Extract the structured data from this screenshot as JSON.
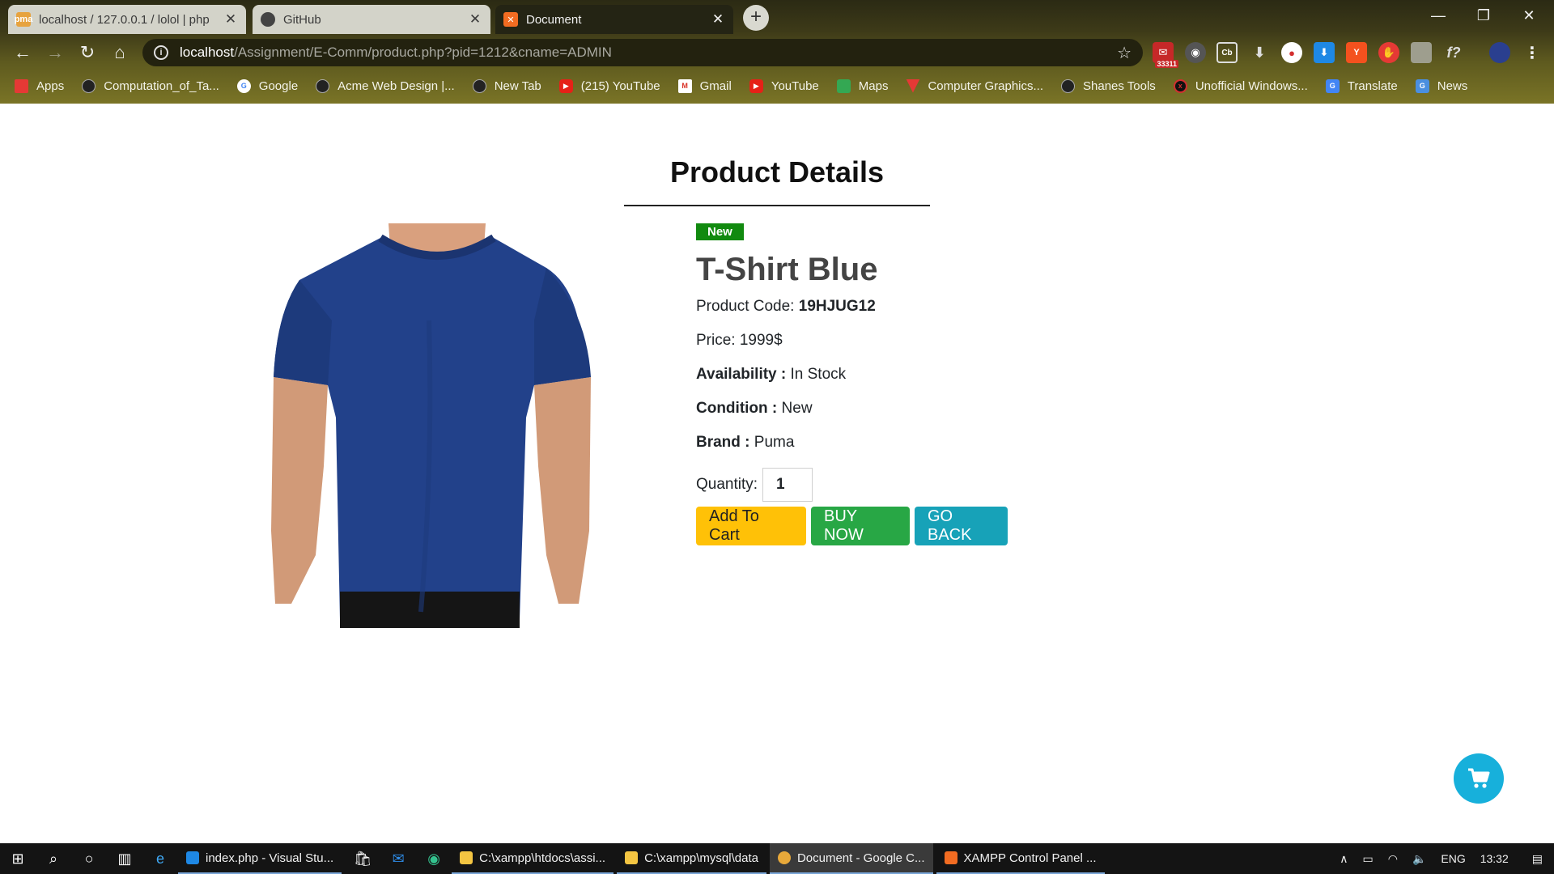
{
  "browser": {
    "tabs": [
      {
        "title": "localhost / 127.0.0.1 / lolol | php",
        "icon": "phpmyadmin-icon"
      },
      {
        "title": "GitHub",
        "icon": "github-icon"
      },
      {
        "title": "Document",
        "icon": "xampp-icon"
      }
    ],
    "url_host": "localhost",
    "url_path": "/Assignment/E-Comm/product.php?pid=1212&cname=ADMIN",
    "extension_badge": "33311",
    "bookmarks": [
      {
        "label": "Apps",
        "icon": "apps-grid-icon"
      },
      {
        "label": "Computation_of_Ta...",
        "icon": "globe-icon"
      },
      {
        "label": "Google",
        "icon": "google-icon"
      },
      {
        "label": "Acme Web Design |...",
        "icon": "globe-icon"
      },
      {
        "label": "New Tab",
        "icon": "globe-icon"
      },
      {
        "label": "(215) YouTube",
        "icon": "youtube-icon"
      },
      {
        "label": "Gmail",
        "icon": "gmail-icon"
      },
      {
        "label": "YouTube",
        "icon": "youtube-icon"
      },
      {
        "label": "Maps",
        "icon": "maps-icon"
      },
      {
        "label": "Computer Graphics...",
        "icon": "vivaldi-icon"
      },
      {
        "label": "Shanes Tools",
        "icon": "globe-icon"
      },
      {
        "label": "Unofficial Windows...",
        "icon": "red-circle-icon"
      },
      {
        "label": "Translate",
        "icon": "translate-icon"
      },
      {
        "label": "News",
        "icon": "news-icon"
      }
    ]
  },
  "page": {
    "heading": "Product Details",
    "badge": "New",
    "product_name": "T-Shirt Blue",
    "code_label": "Product Code:",
    "code_value": "19HJUG12",
    "price_text": "Price: 1999$",
    "availability_label": "Availability :",
    "availability_value": "In Stock",
    "condition_label": "Condition :",
    "condition_value": "New",
    "brand_label": "Brand :",
    "brand_value": "Puma",
    "quantity_label": "Quantity:",
    "quantity_value": "1",
    "buttons": {
      "add_to_cart": "Add To Cart",
      "buy_now": "BUY NOW",
      "go_back": "GO BACK"
    },
    "colors": {
      "badge": "#118a0f",
      "add_to_cart": "#ffc107",
      "buy_now": "#28a745",
      "go_back": "#17a2b8",
      "floating_cart": "#17b0db",
      "shirt": "#22418a"
    }
  },
  "taskbar": {
    "apps": [
      {
        "label": "index.php - Visual Stu...",
        "icon": "vscode-icon"
      },
      {
        "label": "C:\\xampp\\htdocs\\assi...",
        "icon": "folder-icon"
      },
      {
        "label": "C:\\xampp\\mysql\\data",
        "icon": "folder-icon"
      },
      {
        "label": "Document - Google C...",
        "icon": "chrome-icon"
      },
      {
        "label": "XAMPP Control Panel ...",
        "icon": "xampp-icon"
      }
    ],
    "language": "ENG",
    "time": "13:32"
  }
}
